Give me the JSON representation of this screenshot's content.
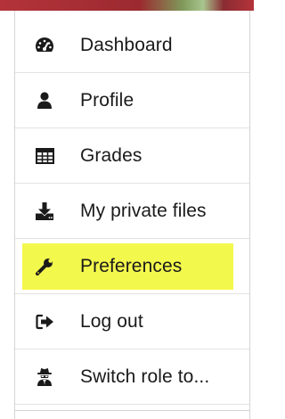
{
  "menu": {
    "items": [
      {
        "label": "Dashboard",
        "icon": "dashboard-icon"
      },
      {
        "label": "Profile",
        "icon": "user-icon"
      },
      {
        "label": "Grades",
        "icon": "table-icon"
      },
      {
        "label": "My private files",
        "icon": "download-icon"
      },
      {
        "label": "Preferences",
        "icon": "wrench-icon",
        "highlighted": true
      },
      {
        "label": "Log out",
        "icon": "sign-out-icon"
      },
      {
        "label": "Switch role to...",
        "icon": "user-secret-icon"
      }
    ]
  },
  "colors": {
    "highlight": "#f3f84d",
    "text": "#1a1a1a",
    "icon": "#1a1a1a",
    "divider": "#e2e2e2"
  }
}
